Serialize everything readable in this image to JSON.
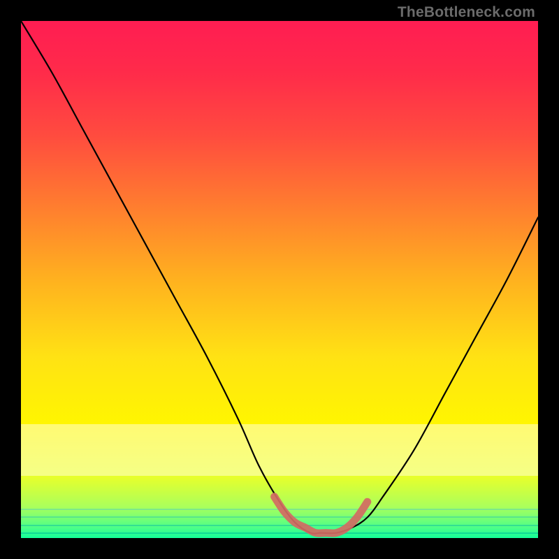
{
  "watermark": "TheBottleneck.com",
  "chart_data": {
    "type": "line",
    "title": "",
    "xlabel": "",
    "ylabel": "",
    "xlim": [
      0,
      100
    ],
    "ylim": [
      0,
      100
    ],
    "grid": false,
    "series": [
      {
        "name": "bottleneck-curve",
        "color": "#000000",
        "x": [
          0,
          6,
          12,
          18,
          24,
          30,
          36,
          42,
          46,
          50,
          53,
          56,
          58,
          61,
          64,
          67,
          70,
          76,
          82,
          88,
          94,
          100
        ],
        "y": [
          100,
          90,
          79,
          68,
          57,
          46,
          35,
          23,
          14,
          7,
          3,
          1,
          1,
          1,
          2,
          4,
          8,
          17,
          28,
          39,
          50,
          62
        ]
      },
      {
        "name": "highlight-bottom",
        "color": "#d36a63",
        "x": [
          49,
          51,
          53,
          55,
          57,
          59,
          61,
          63,
          65,
          67
        ],
        "y": [
          8,
          5,
          3,
          2,
          1,
          1,
          1,
          2,
          4,
          7
        ]
      }
    ],
    "background_gradient_stops": [
      {
        "pos": 0.0,
        "color": "#ff1d52"
      },
      {
        "pos": 0.1,
        "color": "#ff2b4a"
      },
      {
        "pos": 0.22,
        "color": "#ff4b3f"
      },
      {
        "pos": 0.35,
        "color": "#ff7a30"
      },
      {
        "pos": 0.5,
        "color": "#ffb11f"
      },
      {
        "pos": 0.65,
        "color": "#ffe214"
      },
      {
        "pos": 0.78,
        "color": "#fff600"
      },
      {
        "pos": 0.88,
        "color": "#e9ff2a"
      },
      {
        "pos": 0.94,
        "color": "#aaff5c"
      },
      {
        "pos": 0.98,
        "color": "#4cff88"
      },
      {
        "pos": 1.0,
        "color": "#12ff9a"
      }
    ],
    "band_overlay": {
      "from_y": 12,
      "to_y": 22
    },
    "green_stripes": [
      {
        "y": 5.5,
        "color": "#7de88a"
      },
      {
        "y": 4.0,
        "color": "#57e48d"
      },
      {
        "y": 2.5,
        "color": "#33df92"
      },
      {
        "y": 1.0,
        "color": "#12d996"
      }
    ]
  }
}
